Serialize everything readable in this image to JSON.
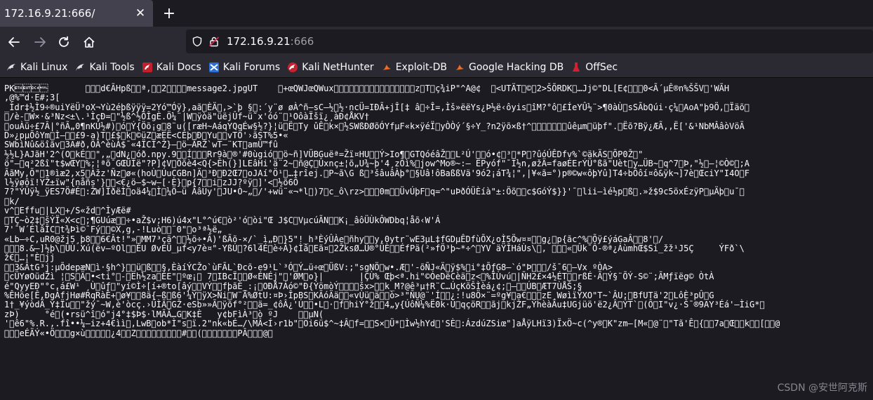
{
  "tab": {
    "title": "172.16.9.21:666/"
  },
  "nav": {
    "url_host": "172.16.9.21",
    "url_port": ":666"
  },
  "bookmarks": [
    {
      "label": "Kali Linux",
      "icon": "kali-dragon-icon"
    },
    {
      "label": "Kali Tools",
      "icon": "kali-dragon-icon"
    },
    {
      "label": "Kali Docs",
      "icon": "kali-docs-icon"
    },
    {
      "label": "Kali Forums",
      "icon": "kali-forums-icon"
    },
    {
      "label": "Kali NetHunter",
      "icon": "nethunter-icon"
    },
    {
      "label": "Exploit-DB",
      "icon": "exploit-db-icon"
    },
    {
      "label": "Google Hacking DB",
      "icon": "ghdb-icon"
    },
    {
      "label": "OffSec",
      "icon": "offsec-icon"
    }
  ],
  "content": {
    "raw": "PK\u0003\u0004\u0014\u0000\t\u0000\b\u0000d€ÃHpß\u0001\u0000ª,\u0000\u00002\u0000\u0000\u0000\u0000message2.jpgUT    \u0000+œQWJœQWux\u0000\u0000\u0000\u0000\u0000\u0000\u0000\u0000\u0000\u0000\u0000\u0000\u0000\u0000\u0000\u0000z\u0000T\u0000ç¾iP\"^A@¢  \u0000<UTÄT\u0000©\u00002>ŠÕRDK\u0000…Jj©\"DL[E¢\u0000\u0000\u00000<Ã´µÊ®n%ŠŠV\u0000'WÃH\n,@%™d·E#;3[\n_Ìdr‡½Ì9÷®uiYëÜ³oX¬Yù2éþßÿÿÿ=2Yó™Óÿ},aã\u0000ÈÄ\u0000,>`þ §\u0000:´y¨ø øÀ^ñ—sC—½\u0000½·ncÜ=IÐÃ+jÎ[‡ â\u0000÷Î=,Ìš»ëëYs¿Þ½ë‹ôyis\u0000îM?°ô\u0000£ÍeYÛ½¨>¶0àÙ\u0000sSÃbQúi·ç¼\u0000AoA\"þ9Ö,\u0000Ïäõ\u0000\n\u0000/è-\u0000W×·&³Nz<±\\.¹ÌçÐ=\u0000\"½ß^½ÕÎgÈ.Ö¼¨|W\u0000ÿòä\"üëjÛf~ü˜x'óó¨\u0000¹OôàÏšï¿¸àÐ¢ÅKV†\n\u0000ouÀü÷£7Â|°ñÃ„0¶nKÚ½#)\u0000ó\u0000Ý{Öõ¡g\u00008¨u([ræH~AáqYQqÉw§½?}¦ü\u0000Ë\u0000Ty ûÊ\u0000k×\u0000½SWßÐØõÓYfµF«k×ÿéÏ\u0000yÒÒý´§÷Y_?n2ÿõ×ß†^\u0000\u0000\u0000\u0000\u0000\u0000\u0000ûêµm\u0000üþf\".\u0000Ëõ?Bÿ¿ÆÃ,,Ë['&¹NbMÂâòVöÄ\nD»¿pµÕôYm\u0000Ì—\u0000\u0000£9-a)T\u0000£$\u0000k\u0000©üZ\u0000æEË<CÈþ\u0000Ð\u0000Yu\u0000\u0000vTÖ'›ãST%5•«\nSWbìNû&öîãv\u00003A#ð,ÕÂ^èùÀ$¯«4ÏCÍ^Ž}—\u0000ö–ÃRŽ`wT—¨KT\u0000amÛ™fû\n½½L}AJãH'2^(O\u0000kÉ\u0000\u0000\",„\u0000dN¿\u0000óð.npy.9\u0000\u0000Í\u0000\u0000\u0000Rr9à\u0000®'#0ùgió\u0000\u0000ö~ñ]VÜBGuëª=Žï¤HU\u0000\u0000Ý>Io¶\u0000GTQóéâŽ\u0000\u0000L²Ú'\u0000\u0000ó•¢\u0000³\u0000*P\u0000?ûóÚÊDfv%`©äkÄS\u0000ÕP0Ž\u0000\"\nö\"—\u0000q²2ßî\"t$wŒY\u0000%;¦ªõ¯GŒÜÍë\"?P]¢V\u0000Öõè4<Q{>Êh(}]LEâHi'ä¨2~\u0000ñ@Ç\u0000Ûxnç±¦õ„U¾~þ'4¸zÕì%\u0000jow^Mo®~:— ÊPyóf\"¯Ì½n,øžÄ=faøÉErÝÜ°ßã\"Uèt\u0000y…ÜB~\u0000q^7\u0000Þ,\"½\u0000—¦©Ò©\u0000;A\nÃãMy,Õ\"\u00001®ìæ2,x5\u0000Àžz'Ñz\u0000ø«(hoÙ\u0000ÚuCGBn]Ä\u0000³Ð\u0000Ð2Œ7\u0000oJAí°Ö¹\u0000…‡rîej.\u0000P~ã\\G ß\u0000³šâuâÀþ°\u0000§Ùâ!ôBaßßVä'9ó2¡áT¾¦\",|¥«ã=°)p®©w«ôþYû]T4÷bÕôí¤ô&ÿk¬]7è\u0000ŒciY\"I4O\u0000F\nl½ÿøôï!YŽ±ïw\"{nåñs'}\u0000\u0000<€¿ö—$~w—[·È}\u0000p{7\u0000\u0000i\u0000zJJ?ºÿ\u0000]'<\u0000½õ6Õ\n7?\"ÝÛÿ½_ÿES7Ö#É\u0000:ŽW]ÌðëÌ\u0000oä4¼\u0000Ì\u0000¼Ö–ü ÃâUy'\u0000JU•Ò~„\u0000/'+wü¨«¬*l\u0000)7\u0000c_ô\\rz>\u0000\u0000\u00000m\u0000\u0000ÜvÚþF\u0000q=^\"uÞðÓÜÈíà\"±:Öõ\u0000\u0000c$GóÝ$}}'¯\u0000lii—ìé½p\u0000ß\u0000.»ž$9c5öxÉzÿP\u0000µÄþ\u0000u¯\u0000\n\u0000k/\nv^\u0000Effu\u0000|LX\u0000+/S«žd\u0000^ÌyÆë#\n\u0000TÇ~ò2‡\u0000šÝÏ«X<c\u0000;¶GUúæ\u0000\u0000÷•aŽ$v;H6)ú4x\"L°^ú€\u0000ò²'ó\u0000òi\"Œ J$C\u0000VµcúÃN\u0000\u0000K¡_âôÜÙkÔWDbq¦åõ‹W'Á\n7'¯W´ÉlâÎC\u0000t¾Þì©¯Fý\u0000\u0000©X,g,-!Luò\u0000\u0000¨0\"\u0000o³ª½ë„\n«Lb—÷C,uR0@žj5¸þ8\u0000\u00006€Ât!\"»\u0000MM7³çä^\u0000\u0000½ö÷•Â)'ßÃõ-×/`_ì„Ð\u0000}5\"!_h³ÈýÛÀe\u0000ñhy\u0000\u0000y,0ytr¨wE3µL‡fGDµÊDfùÕX¿oÌ5Öw¤¤\u0000\u0000g¿\u0000p{ãc^%\u0000Õÿ£ýáGaÂ\u0000\u00008'\u0000/\n\u0000\u0000\u00008.&—]½þ\\\u0000ÛÙ.Xú(ëv—ºOl\u0000\u0000ÉU ØvEÜ_µf<y7è¤\"-YßÚ\u0000?6l4É\u0000è÷Â}¢Ìâ\u0000Eã¤\u00002ŽksØ…Ü®°ÜÈ\u0000\u0000ÉfPä(²»fÖ³þ~*÷^\u0000YV äŸÎHáÙs\\\u0000, \u0000\u0000\u0000«\u0000Ûk¯Ô-®ª¿ÁùmhŒ$Si_žž¹J5Ç     ÝFð`\\\nž€\u0000…¦\"È\u0000jj\n\u0000\u00003&ÂtG³j:µÕdepæN\u0000ì·§h^}\u0000\u0000ü\u0000ß\u0000\u0000§,ÈàíÝCŽo`ùFÃL`Ðcõ-e9¹L`³Ó\u0000Ý…ü÷œ\u0000ÜßV:;\"sgNÖ\u0000w•.Æ\u0000'-õÑJ«Ä\u0000ÿ$%\u0000i°‡ÕƒG8—`ó\"Þ\u0000\u0000\u0000/š¯6\u0000—Vx ºÒA>\n\u0000cÜYøOüdŽì ¦\u0000S\u0000Ä\u0000•<ti°\u0000-\u0000Eh½za\u0000ÉE\"\u0000ºœ¡\u0000 7\u0000IBcÏ\u0000\u0000Ø«ÉNÉj\"\u0000'ØM\u0000o}|       |ÇÙ% Œþ<ª.hi\"©ÓeDëCèä\u0000z<\u0000%ÎÙvú\u0000|ÑH2£×4½ÉT\u0000\u0000rßÉ·Ã\u0000Ý§¨ÕÝ-S©¨;ÃMƒïëg© ÒtÀ\né\"QyyEÐ\"°c,á£W¹ ¸Ù\u0000ûƒ\u0000\"yí©Ì÷[í+®to[âý\u0000\u0000VÝ\u0000\u0000fþãÈ_:¡\u0000OÐÅ7Áó©\"Ð{ÝömòÝ\u0000\u0000\u0000\u0000šx>\u0000\u0000k_M?@ê³µ†R¨C…ÚçKõŠÌèá¿¢;\u0000–\u0000\u0000ÚB\u0000ÆT7ÙÅŠ;§\n%ÊHöe[Ê,ÐgÁfjHø#RqRàÉ+\u0000ø¥\u0000\u00008ä{—ß\u0000ß6'¼Ý\u0000ÿX>Ñi\u0000W¨Ã%ØtU:¤Þ›ÎpBS\u0000KÃóÄä\u0000\u0000«vÙü\u0000ä\u0000\u0000ò>³\"ÑU@¨'Í\u0000\u0000¿:!u8Ö×¨=ºg¥\u0000a€\u0000\u0000\u0000zE¸WøìïŸXO\"T~`ÂU;\u0000BfUTä'2\u0000LôÈ³pÛ\u0000G\n1†_¥ýòdÄ_Ý‡Ïu\u0000\u0000\"žý¯~W,è'òcç.›ÛÌÃ\u0000GŽ·eSb»»Ã\u0000ÿõf°²\u0000\u0000ä=_¢ôÂ¿'Ú\u0000\u0000•L\u0000·\u0000f\u0000hiÝ°ž\u0000\u00004„y{ÚôÑ¼%Ë0k·Ù\u0000qçöR\u0000\u0000ãj\u0000kjŽF„ÝhèàÃu‡UGjüö'ë2¿Â\u0000ÝT`\u0000(Ô\u0000I\"v¿·Š¯®9AY³Éá'—ÌiG*\u0000\nzÞ)     °é\u0000(•rsü^î\u0000ó\"j4°‡$Þ$·lMÃÂ…G\u0000K‡È   y¢bFìÀ³\u0000ò ºJ    \u0000\u0000µN(\n'\u0000ê6\"%.R.,.fî••¼—iz+4€ìì\u0000,LwB\u0000ob*Ì\"s\u0000ï.2\"nk«bÉ…/\\MÂ<Í›r1b\"\u0000Oi6ü$^~‡Â\u0000f=\u0000\u0000S×\u0000Ü*\u0000Ìw½hYd\u0000'SÈ\u0000:ÁzdúZSiœ\"]aÅÿLHï3)ÏxÖ~c(^y®\u0000K\"zm—[M«\u0000@¨\u0000\"Tã'Ê\u0000{\u0000\u00007a\u0000Œ\u0000\u0000k\u0000\u0000[\u0000\u0000@\n\u0000\u0000\u0000eÉÄÝ«•Ö\u0000\u0000\u0000g×ù\u0000\u0000\u0000\u0000\u0000¿4\u0000\u0000Z\u0000\u0000\u0000\u0000\u0000\u0000\u0000\u0000\u0000#\u0000\u0000(\u0000\u0000\u0000\u0000\u0000\u0000\u0000PÂ\u0000\u0000\u0000@\u0000"
  },
  "watermark": "CSDN @安世阿克斯"
}
